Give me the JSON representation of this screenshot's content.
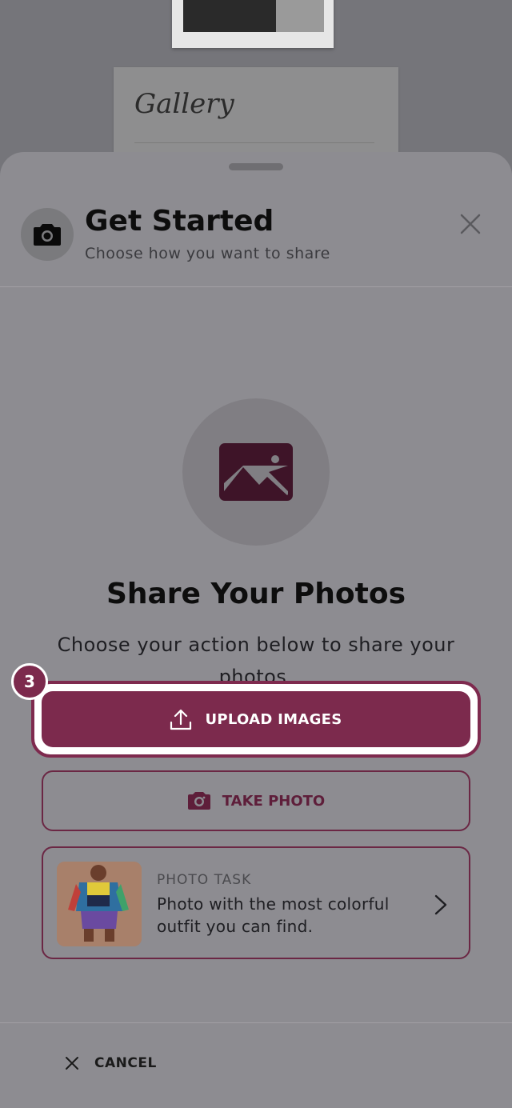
{
  "background": {
    "gallery_title": "Gallery"
  },
  "sheet": {
    "title": "Get Started",
    "subtitle": "Choose how you want to share",
    "main_title": "Share Your Photos",
    "main_description": "Choose your action below to share your photos.",
    "step_number": "3",
    "upload_label": "UPLOAD IMAGES",
    "take_photo_label": "TAKE PHOTO",
    "task": {
      "label": "PHOTO TASK",
      "text": "Photo with the most colorful outfit you can find."
    },
    "cancel_label": "CANCEL"
  },
  "icons": {
    "header": "camera-icon",
    "close": "close-icon",
    "hero": "image-icon",
    "upload": "upload-icon",
    "take_photo": "camera-icon",
    "chevron": "chevron-right-icon",
    "cancel": "close-icon"
  },
  "colors": {
    "accent": "#7c2a4d",
    "overlay": "#8d8c91"
  }
}
